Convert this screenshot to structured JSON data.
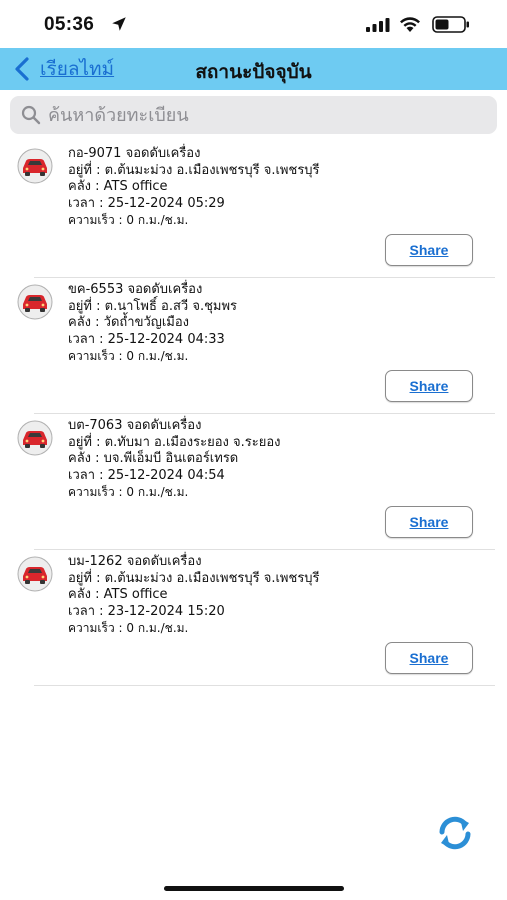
{
  "status_bar": {
    "time": "05:36",
    "icons": [
      "location-arrow-icon",
      "signal-icon",
      "wifi-icon",
      "battery-icon"
    ]
  },
  "nav": {
    "back_label": "เรียลไทม์",
    "title": "สถานะปัจจุบัน",
    "background_color": "#6ecbf2",
    "link_color": "#1a6fd1"
  },
  "search": {
    "placeholder": "ค้นหาด้วยทะเบียน",
    "value": ""
  },
  "vehicles": [
    {
      "header": "กอ-9071 จอดดับเครื่อง",
      "location": "อยู่ที่ : ต.ต้นมะม่วง อ.เมืองเพชรบุรี จ.เพชรบุรี",
      "depot": "คลัง : ATS office",
      "time": "เวลา : 25-12-2024 05:29",
      "speed": "ความเร็ว : 0 ก.ม./ช.ม.",
      "share_label": "Share"
    },
    {
      "header": "ขค-6553 จอดดับเครื่อง",
      "location": "อยู่ที่ : ต.นาโพธิ์ อ.สวี จ.ชุมพร",
      "depot": "คลัง : วัดถ้ำขวัญเมือง",
      "time": "เวลา : 25-12-2024 04:33",
      "speed": "ความเร็ว : 0 ก.ม./ช.ม.",
      "share_label": "Share"
    },
    {
      "header": "บต-7063 จอดดับเครื่อง",
      "location": "อยู่ที่ : ต.ทับมา อ.เมืองระยอง จ.ระยอง",
      "depot": "คลัง : บจ.พีเอ็มบี อินเตอร์เทรด",
      "time": "เวลา : 25-12-2024 04:54",
      "speed": "ความเร็ว : 0 ก.ม./ช.ม.",
      "share_label": "Share"
    },
    {
      "header": "บม-1262 จอดดับเครื่อง",
      "location": "อยู่ที่ : ต.ต้นมะม่วง อ.เมืองเพชรบุรี จ.เพชรบุรี",
      "depot": "คลัง : ATS office",
      "time": "เวลา : 23-12-2024 15:20",
      "speed": "ความเร็ว : 0 ก.ม./ช.ม.",
      "share_label": "Share"
    }
  ],
  "status_color": "#d9262c"
}
